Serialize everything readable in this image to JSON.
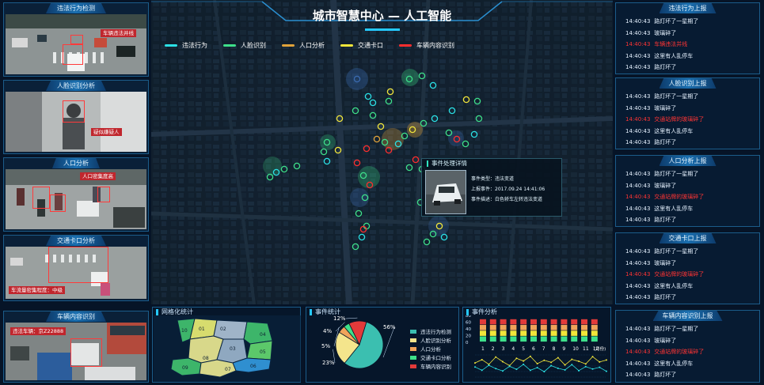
{
  "header": {
    "title": "城市智慧中心 — 人工智能"
  },
  "legend": [
    {
      "label": "违法行为",
      "color": "#2be1e6"
    },
    {
      "label": "人脸识别",
      "color": "#3ee08a"
    },
    {
      "label": "人口分析",
      "color": "#e0a23a"
    },
    {
      "label": "交通卡口",
      "color": "#f2e63a"
    },
    {
      "label": "车辆内容识别",
      "color": "#ff2e2e"
    }
  ],
  "cameras": [
    {
      "title": "违法行为检测",
      "tag": "车辆违法并线"
    },
    {
      "title": "人脸识别分析",
      "tag": "疑似嫌疑人"
    },
    {
      "title": "人口分析",
      "tag": "人口密集度高"
    },
    {
      "title": "交通卡口分析",
      "tag": "车流量密集程度：中级"
    },
    {
      "title": "车辆内容识别",
      "tag": "违法车辆：京Z22888"
    }
  ],
  "right_panels": [
    {
      "title": "违法行为上报",
      "rows": [
        {
          "time": "14:40:43",
          "text": "路灯坏了一星期了",
          "alert": false
        },
        {
          "time": "14:40:43",
          "text": "玻璃碎了",
          "alert": false
        },
        {
          "time": "14:40:43",
          "text": "车辆违法并线",
          "alert": true
        },
        {
          "time": "14:40:43",
          "text": "这里有人乱停车",
          "alert": false
        },
        {
          "time": "14:40:43",
          "text": "路灯坏了",
          "alert": false
        }
      ]
    },
    {
      "title": "人脸识别上报",
      "rows": [
        {
          "time": "14:40:43",
          "text": "路灯坏了一星期了",
          "alert": false
        },
        {
          "time": "14:40:43",
          "text": "玻璃碎了",
          "alert": false
        },
        {
          "time": "14:40:43",
          "text": "交通站牌的玻璃碎了",
          "alert": true
        },
        {
          "time": "14:40:43",
          "text": "这里有人乱停车",
          "alert": false
        },
        {
          "time": "14:40:43",
          "text": "路灯坏了",
          "alert": false
        }
      ]
    },
    {
      "title": "人口分析上报",
      "rows": [
        {
          "time": "14:40:43",
          "text": "路灯坏了一星期了",
          "alert": false
        },
        {
          "time": "14:40:43",
          "text": "玻璃碎了",
          "alert": false
        },
        {
          "time": "14:40:43",
          "text": "交通站牌的玻璃碎了",
          "alert": true
        },
        {
          "time": "14:40:43",
          "text": "这里有人乱停车",
          "alert": false
        },
        {
          "time": "14:40:43",
          "text": "路灯坏了",
          "alert": false
        }
      ]
    },
    {
      "title": "交通卡口上报",
      "rows": [
        {
          "time": "14:40:43",
          "text": "路灯坏了一星期了",
          "alert": false
        },
        {
          "time": "14:40:43",
          "text": "玻璃碎了",
          "alert": false
        },
        {
          "time": "14:40:43",
          "text": "交通站牌的玻璃碎了",
          "alert": true
        },
        {
          "time": "14:40:43",
          "text": "这里有人乱停车",
          "alert": false
        },
        {
          "time": "14:40:43",
          "text": "路灯坏了",
          "alert": false
        }
      ]
    },
    {
      "title": "车辆内容识别上报",
      "rows": [
        {
          "time": "14:40:43",
          "text": "路灯坏了一星期了",
          "alert": false
        },
        {
          "time": "14:40:43",
          "text": "玻璃碎了",
          "alert": false
        },
        {
          "time": "14:40:43",
          "text": "交通站牌的玻璃碎了",
          "alert": true
        },
        {
          "time": "14:40:43",
          "text": "这里有人乱停车",
          "alert": false
        },
        {
          "time": "14:40:43",
          "text": "路灯坏了",
          "alert": false
        }
      ]
    }
  ],
  "popup": {
    "title": "事件处理详情",
    "type_label": "事件类型：",
    "type_value": "违法变道",
    "time_label": "上报事件：",
    "time_value": "2017.09.24  14:41:06",
    "desc_label": "事件描述：",
    "desc_value": "白色轿车左转违法变道"
  },
  "grid_panel": {
    "title": "网格化统计",
    "regions": [
      "01",
      "02",
      "03",
      "04",
      "05",
      "06",
      "07",
      "08",
      "09",
      "10"
    ]
  },
  "event_panel": {
    "title": "事件统计"
  },
  "analysis_panel": {
    "title": "事件分析",
    "x_unit": "(月份)"
  },
  "chart_data": [
    {
      "type": "pie",
      "title": "事件统计",
      "categories": [
        "违法行为检测",
        "人脸识别分析",
        "人口分析",
        "交通卡口分析",
        "车辆内容识别"
      ],
      "values": [
        56,
        23,
        5,
        4,
        12
      ],
      "labels": [
        "56%",
        "23%",
        "5%",
        "4%",
        "12%"
      ],
      "colors": [
        "#3bbfb0",
        "#f4e58c",
        "#f0a35a",
        "#3ee08a",
        "#e23a3a"
      ]
    },
    {
      "type": "bar",
      "title": "事件分析",
      "xlabel": "(月份)",
      "categories": [
        "1",
        "2",
        "3",
        "4",
        "5",
        "6",
        "7",
        "8",
        "9",
        "10",
        "11",
        "12"
      ],
      "y_ticks": [
        0,
        20,
        40,
        60,
        80
      ],
      "ylim": [
        0,
        80
      ],
      "series": [
        {
          "values": [
            20,
            20,
            20,
            20,
            20,
            20,
            20,
            20,
            20,
            20,
            20,
            20
          ],
          "color": "#3ee08a"
        },
        {
          "values": [
            20,
            20,
            20,
            20,
            20,
            20,
            20,
            20,
            20,
            20,
            20,
            20
          ],
          "color": "#f2e63a"
        },
        {
          "values": [
            20,
            20,
            20,
            20,
            20,
            20,
            20,
            20,
            20,
            20,
            20,
            20
          ],
          "color": "#f0a35a"
        },
        {
          "values": [
            20,
            20,
            20,
            20,
            20,
            20,
            20,
            20,
            20,
            20,
            20,
            20
          ],
          "color": "#e23a3a"
        }
      ]
    },
    {
      "type": "line",
      "series": [
        {
          "values": [
            52,
            62,
            48,
            70,
            56,
            44,
            66,
            58,
            72,
            50,
            60,
            54,
            68,
            46,
            63,
            57,
            49,
            71,
            55,
            61
          ],
          "color": "#f2e63a"
        },
        {
          "values": [
            40,
            30,
            45,
            35,
            28,
            42,
            33,
            48,
            30,
            38,
            26,
            44,
            36,
            31,
            47,
            29,
            41,
            34,
            39,
            27
          ],
          "color": "#2be1e6"
        }
      ]
    }
  ]
}
